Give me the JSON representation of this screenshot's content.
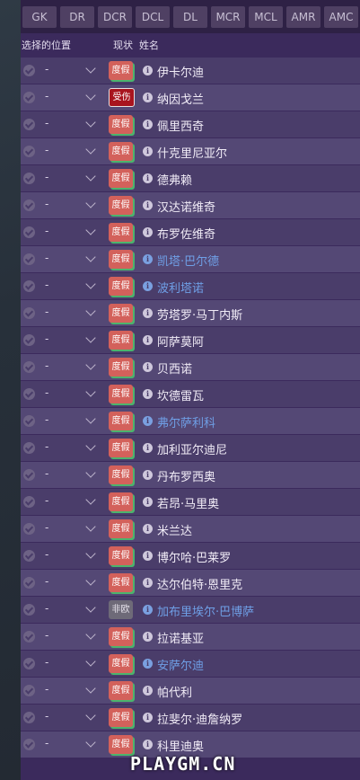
{
  "positions": [
    "GK",
    "DR",
    "DCR",
    "DCL",
    "DL",
    "MCR",
    "MCL",
    "AMR",
    "AMC"
  ],
  "header": {
    "selected_position": "选择的位置",
    "status": "现状",
    "name": "姓名"
  },
  "rows": [
    {
      "pos": "-",
      "status": "度假",
      "name": "伊卡尔迪",
      "type": "holiday",
      "blue": false
    },
    {
      "pos": "-",
      "status": "受伤",
      "name": "纳因戈兰",
      "type": "injured",
      "blue": false
    },
    {
      "pos": "-",
      "status": "度假",
      "name": "佩里西奇",
      "type": "holiday",
      "blue": false
    },
    {
      "pos": "-",
      "status": "度假",
      "name": "什克里尼亚尔",
      "type": "holiday",
      "blue": false
    },
    {
      "pos": "-",
      "status": "度假",
      "name": "德弗赖",
      "type": "holiday",
      "blue": false
    },
    {
      "pos": "-",
      "status": "度假",
      "name": "汉达诺维奇",
      "type": "holiday",
      "blue": false
    },
    {
      "pos": "-",
      "status": "度假",
      "name": "布罗佐维奇",
      "type": "holiday",
      "blue": false
    },
    {
      "pos": "-",
      "status": "度假",
      "name": "凯塔·巴尔德",
      "type": "holiday",
      "blue": true
    },
    {
      "pos": "-",
      "status": "度假",
      "name": "波利塔诺",
      "type": "holiday",
      "blue": true
    },
    {
      "pos": "-",
      "status": "度假",
      "name": "劳塔罗·马丁内斯",
      "type": "holiday",
      "blue": false
    },
    {
      "pos": "-",
      "status": "度假",
      "name": "阿萨莫阿",
      "type": "holiday",
      "blue": false
    },
    {
      "pos": "-",
      "status": "度假",
      "name": "贝西诺",
      "type": "holiday",
      "blue": false
    },
    {
      "pos": "-",
      "status": "度假",
      "name": "坎德雷瓦",
      "type": "holiday",
      "blue": false
    },
    {
      "pos": "-",
      "status": "度假",
      "name": "弗尔萨利科",
      "type": "holiday",
      "blue": true
    },
    {
      "pos": "-",
      "status": "度假",
      "name": "加利亚尔迪尼",
      "type": "holiday",
      "blue": false
    },
    {
      "pos": "-",
      "status": "度假",
      "name": "丹布罗西奥",
      "type": "holiday",
      "blue": false
    },
    {
      "pos": "-",
      "status": "度假",
      "name": "若昂·马里奥",
      "type": "holiday",
      "blue": false
    },
    {
      "pos": "-",
      "status": "度假",
      "name": "米兰达",
      "type": "holiday",
      "blue": false
    },
    {
      "pos": "-",
      "status": "度假",
      "name": "博尔哈·巴莱罗",
      "type": "holiday",
      "blue": false
    },
    {
      "pos": "-",
      "status": "度假",
      "name": "达尔伯特·恩里克",
      "type": "holiday",
      "blue": false
    },
    {
      "pos": "-",
      "status": "非欧",
      "name": "加布里埃尔·巴博萨",
      "type": "noneu",
      "blue": true
    },
    {
      "pos": "-",
      "status": "度假",
      "name": "拉诺基亚",
      "type": "holiday",
      "blue": false
    },
    {
      "pos": "-",
      "status": "度假",
      "name": "安萨尔迪",
      "type": "holiday",
      "blue": true
    },
    {
      "pos": "-",
      "status": "度假",
      "name": "帕代利",
      "type": "holiday",
      "blue": false
    },
    {
      "pos": "-",
      "status": "度假",
      "name": "拉斐尔·迪詹纳罗",
      "type": "holiday",
      "blue": false
    },
    {
      "pos": "-",
      "status": "度假",
      "name": "科里迪奥",
      "type": "holiday",
      "blue": false
    }
  ],
  "watermark": "PLAYGM.CN",
  "colors": {
    "holiday": "#d3615b",
    "injured": "#a8141e",
    "noneu": "#6e6a78",
    "blue_name": "#6f9fe6"
  }
}
